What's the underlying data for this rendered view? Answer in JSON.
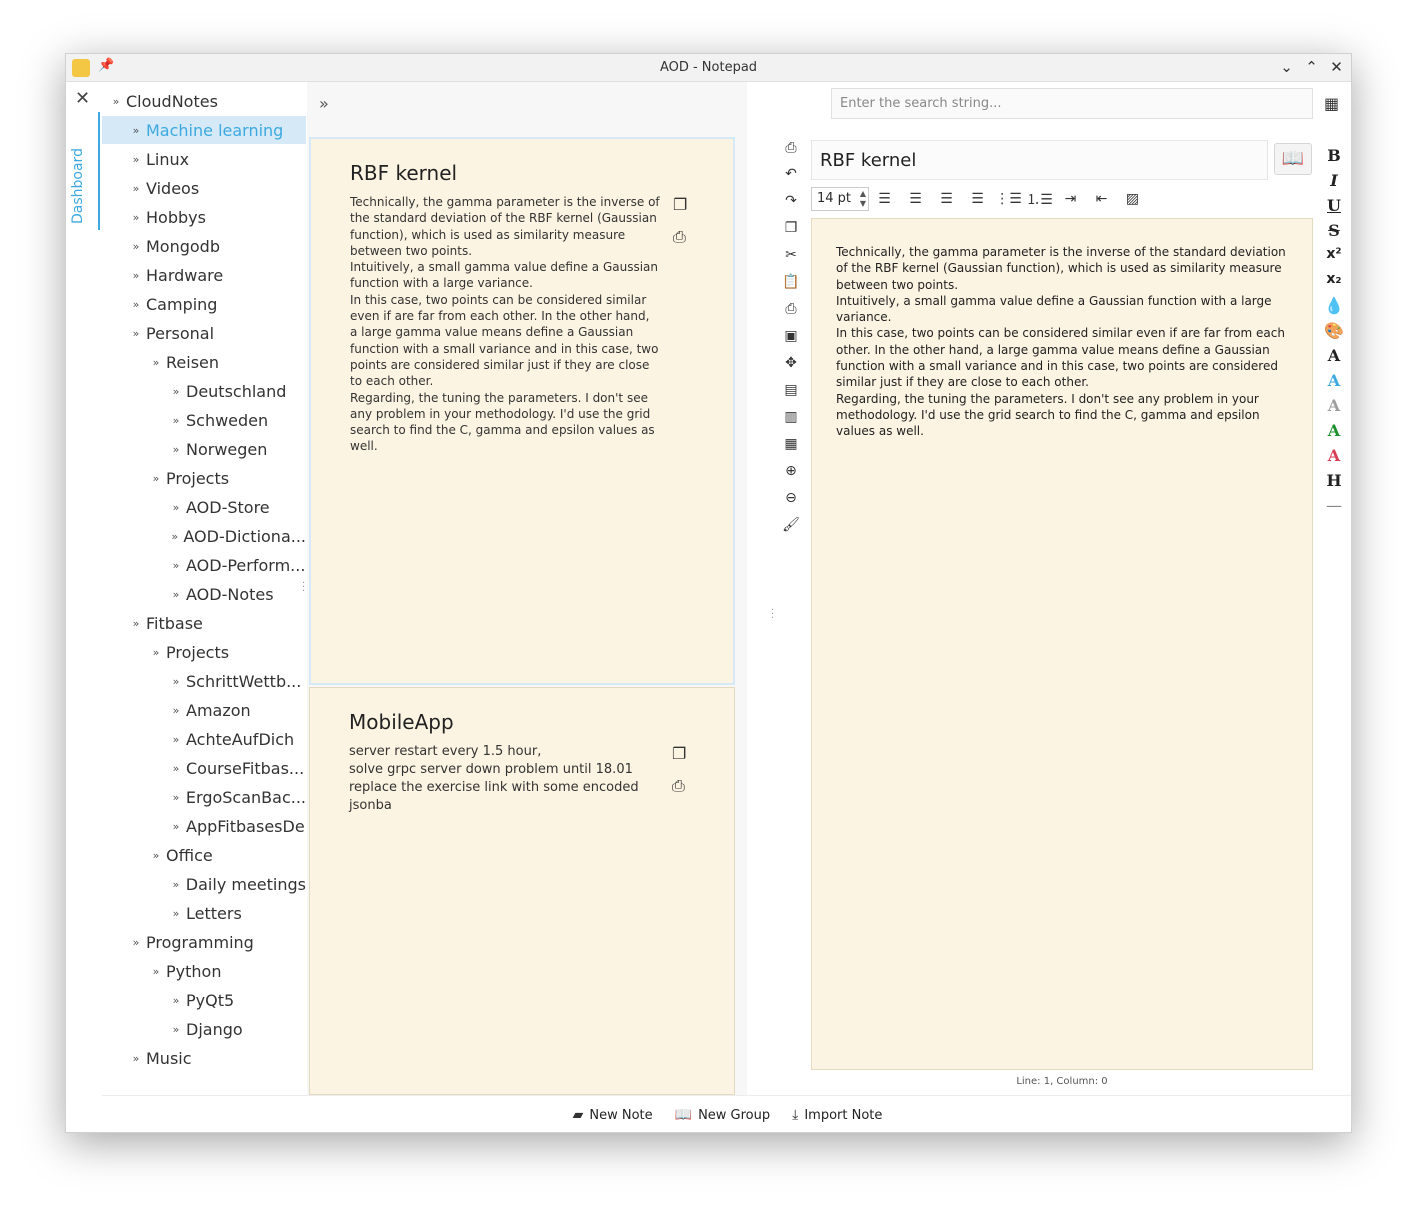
{
  "window": {
    "title": "AOD - Notepad"
  },
  "sidebar": {
    "close_glyph": "✕",
    "dashboard_label": "Dashboard"
  },
  "tree": {
    "items": [
      {
        "label": "CloudNotes"
      },
      {
        "label": "Machine learning"
      },
      {
        "label": "Linux"
      },
      {
        "label": "Videos"
      },
      {
        "label": "Hobbys"
      },
      {
        "label": "Mongodb"
      },
      {
        "label": "Hardware"
      },
      {
        "label": "Camping"
      },
      {
        "label": "Personal"
      },
      {
        "label": "Reisen"
      },
      {
        "label": "Deutschland"
      },
      {
        "label": "Schweden"
      },
      {
        "label": "Norwegen"
      },
      {
        "label": "Projects"
      },
      {
        "label": "AOD-Store"
      },
      {
        "label": "AOD-Dictiona..."
      },
      {
        "label": "AOD-Perform..."
      },
      {
        "label": "AOD-Notes"
      },
      {
        "label": "Fitbase"
      },
      {
        "label": "Projects"
      },
      {
        "label": "SchrittWettb..."
      },
      {
        "label": "Amazon"
      },
      {
        "label": "AchteAufDich"
      },
      {
        "label": "CourseFitbas..."
      },
      {
        "label": "ErgoScanBac..."
      },
      {
        "label": "AppFitbasesDe"
      },
      {
        "label": "Office"
      },
      {
        "label": "Daily meetings"
      },
      {
        "label": "Letters"
      },
      {
        "label": "Programming"
      },
      {
        "label": "Python"
      },
      {
        "label": "PyQt5"
      },
      {
        "label": "Django"
      },
      {
        "label": "Music"
      }
    ]
  },
  "cards": [
    {
      "title": "RBF kernel",
      "body": "Technically, the gamma parameter is the inverse of the standard deviation of the RBF kernel (Gaussian function), which is used as similarity measure between two points.\nIntuitively, a small gamma value define a Gaussian function with a large variance.\nIn this case, two points can be considered similar even if are far from each other. In the other hand, a large gamma value means define a Gaussian function with a small variance and in this case, two points are considered similar just if they are close to each other.\nRegarding, the tuning the parameters. I don't see any problem in your methodology. I'd use the grid search to find the C, gamma and epsilon values as well."
    },
    {
      "title": "MobileApp",
      "body": "server restart every 1.5 hour,\nsolve grpc server down problem until 18.01\nreplace the exercise link with some encoded\njsonba"
    }
  ],
  "search": {
    "placeholder": "Enter the search string..."
  },
  "editor": {
    "title": "RBF kernel",
    "font_size": "14 pt",
    "text": "Technically, the gamma parameter is the inverse of the standard deviation of the RBF kernel (Gaussian function), which is used as similarity measure between two points.\nIntuitively, a small gamma value define a Gaussian function with a large variance.\nIn this case, two points can be considered similar even if are far from each other. In the other hand, a large gamma value means define a Gaussian function with a small variance and in this case, two points are considered similar just if they are close to each other.\nRegarding, the tuning the parameters. I don't see any problem in your methodology. I'd use the grid search to find the C, gamma and epsilon values as well.",
    "status": "Line: 1, Column: 0"
  },
  "format_tools": {
    "bold": "B",
    "italic": "I",
    "underline": "U",
    "strike": "S",
    "superscript": "x²",
    "subscript": "x₂",
    "heading": "H",
    "rule": "—"
  },
  "bottombar": {
    "new_note": "New Note",
    "new_group": "New Group",
    "import_note": "Import Note"
  },
  "colors": {
    "accent": "#3da9e0",
    "note_bg": "#fcf4e2",
    "selection_bg": "#d5e9f7",
    "color_a_blue": "#3da9e0",
    "color_a_gray": "#9e9e9e",
    "color_a_green": "#1e8f2e",
    "color_a_red": "#d64055"
  }
}
